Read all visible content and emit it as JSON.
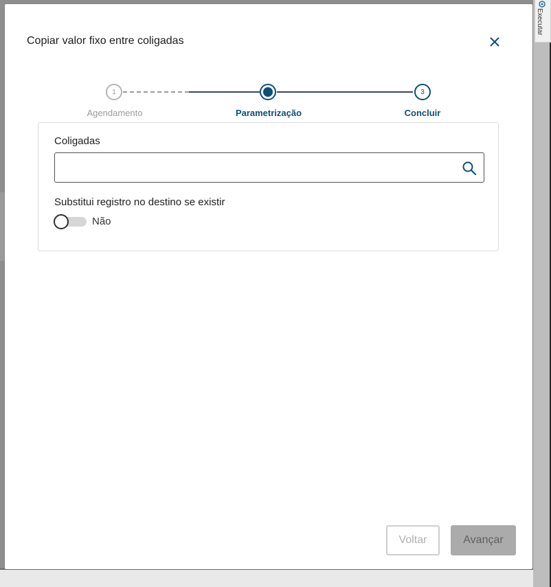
{
  "dialog": {
    "title": "Copiar valor fixo entre coligadas",
    "close_icon": "close-icon"
  },
  "stepper": {
    "steps": [
      {
        "number": "1",
        "label": "Agendamento",
        "state": "completed"
      },
      {
        "number": "",
        "label": "Parametrização",
        "state": "active"
      },
      {
        "number": "3",
        "label": "Concluir",
        "state": "pending"
      }
    ]
  },
  "form": {
    "coligadas_label": "Coligadas",
    "coligadas_value": "",
    "coligadas_placeholder": "",
    "substitui_label": "Substitui registro no destino se existir",
    "toggle_state": "off",
    "toggle_text": "Não"
  },
  "footer": {
    "back_label": "Voltar",
    "next_label": "Avançar"
  },
  "side_panel": {
    "tab_label": "Executar"
  },
  "colors": {
    "accent": "#0c4f78",
    "inactive": "#9b9b9b"
  }
}
